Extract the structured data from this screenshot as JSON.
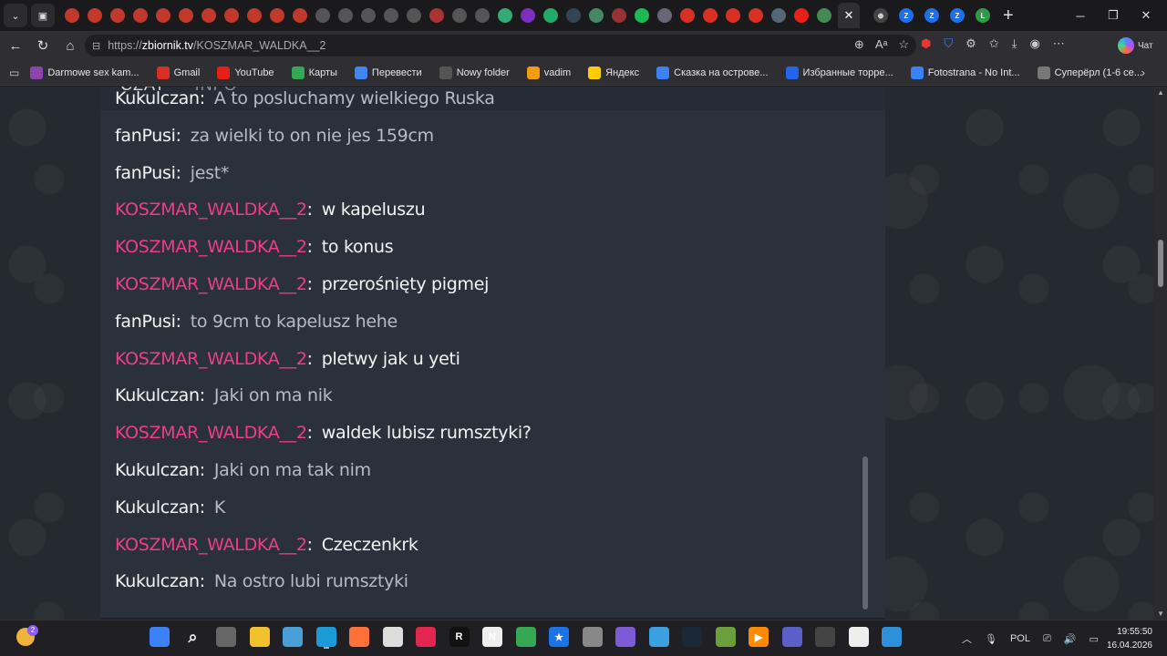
{
  "browser": {
    "url": {
      "protocol": "https://",
      "host": "zbiornik.tv",
      "path": "/KOSZMAR_WALDKA__2"
    },
    "copilot_label": "Чат",
    "tab_favicons": [
      {
        "icon": "red-circle-icon",
        "color": "#c0392b"
      },
      {
        "icon": "red-circle-icon",
        "color": "#c0392b"
      },
      {
        "icon": "red-circle-icon",
        "color": "#c0392b"
      },
      {
        "icon": "red-circle-icon",
        "color": "#c0392b"
      },
      {
        "icon": "red-circle-icon",
        "color": "#c0392b"
      },
      {
        "icon": "red-circle-icon",
        "color": "#c0392b"
      },
      {
        "icon": "red-circle-icon",
        "color": "#c0392b"
      },
      {
        "icon": "red-circle-icon",
        "color": "#c0392b"
      },
      {
        "icon": "red-circle-icon",
        "color": "#c0392b"
      },
      {
        "icon": "red-circle-icon",
        "color": "#c0392b"
      },
      {
        "icon": "red-circle-icon",
        "color": "#c0392b"
      },
      {
        "icon": "hd-icon",
        "color": "#555"
      },
      {
        "icon": "hd-icon",
        "color": "#555"
      },
      {
        "icon": "hd-icon",
        "color": "#555"
      },
      {
        "icon": "hd-icon",
        "color": "#555"
      },
      {
        "icon": "hd-icon",
        "color": "#555"
      },
      {
        "icon": "red-circle-icon",
        "color": "#a33"
      },
      {
        "icon": "hd-icon",
        "color": "#555"
      },
      {
        "icon": "hd-icon",
        "color": "#555"
      },
      {
        "icon": "chart-icon",
        "color": "#3a7"
      },
      {
        "icon": "purple-icon",
        "color": "#7b2fbf"
      },
      {
        "icon": "green-icon",
        "color": "#2a6"
      },
      {
        "icon": "steam-icon",
        "color": "#345"
      },
      {
        "icon": "image-icon",
        "color": "#486"
      },
      {
        "icon": "arrow-icon",
        "color": "#933"
      },
      {
        "icon": "spotify-icon",
        "color": "#1db954"
      },
      {
        "icon": "image-icon",
        "color": "#667"
      },
      {
        "icon": "gmail-icon",
        "color": "#d93025"
      },
      {
        "icon": "gmail-icon",
        "color": "#d93025"
      },
      {
        "icon": "gmail-icon",
        "color": "#d93025"
      },
      {
        "icon": "gmail-icon",
        "color": "#d93025"
      },
      {
        "icon": "image-icon",
        "color": "#567"
      },
      {
        "icon": "youtube-icon",
        "color": "#e62117"
      },
      {
        "icon": "image-icon",
        "color": "#485"
      }
    ],
    "active_tab_close": "✕",
    "right_tab_favicons": [
      {
        "icon": "globe-icon",
        "label": "⊕",
        "color": "#444"
      },
      {
        "icon": "z-icon",
        "label": "Z",
        "color": "#1f6feb"
      },
      {
        "icon": "z-icon",
        "label": "Z",
        "color": "#1f6feb"
      },
      {
        "icon": "z-icon",
        "label": "Z",
        "color": "#1f6feb"
      },
      {
        "icon": "l-icon",
        "label": "L",
        "color": "#2e9b4a"
      }
    ],
    "window_controls": [
      "─",
      "❐",
      "✕"
    ]
  },
  "bookmarks": [
    {
      "label": "Darmowe sex kam...",
      "icon": "camera-icon",
      "color": "#8e44ad"
    },
    {
      "label": "Gmail",
      "icon": "gmail-icon",
      "color": "#d93025"
    },
    {
      "label": "YouTube",
      "icon": "youtube-icon",
      "color": "#e62117"
    },
    {
      "label": "Карты",
      "icon": "maps-icon",
      "color": "#34a853"
    },
    {
      "label": "Перевести",
      "icon": "translate-icon",
      "color": "#4285f4"
    },
    {
      "label": "Nowy folder",
      "icon": "folder-icon",
      "color": "#555"
    },
    {
      "label": "vadim",
      "icon": "mail-icon",
      "color": "#f39c12"
    },
    {
      "label": "Яндекс",
      "icon": "yandex-icon",
      "color": "#ffcc00"
    },
    {
      "label": "Сказка на острове...",
      "icon": "star-icon",
      "color": "#3b82f6"
    },
    {
      "label": "Избранные торре...",
      "icon": "torrent-icon",
      "color": "#2563eb"
    },
    {
      "label": "Fotostrana - No Int...",
      "icon": "fotostrana-icon",
      "color": "#3b82f6"
    },
    {
      "label": "Суперёрл (1-6 се...",
      "icon": "hat-icon",
      "color": "#777"
    }
  ],
  "chat": {
    "tabs": [
      "CZAT",
      "INFO"
    ],
    "messages": [
      {
        "user": "Kukulczan",
        "text": "A to posluchamy wielkiego Ruska",
        "highlight": false
      },
      {
        "user": "fanPusi",
        "text": "za wielki to on nie jes 159cm",
        "highlight": false
      },
      {
        "user": "fanPusi",
        "text": "jest*",
        "highlight": false
      },
      {
        "user": "KOSZMAR_WALDKA__2",
        "text": "w kapeluszu",
        "highlight": true
      },
      {
        "user": "KOSZMAR_WALDKA__2",
        "text": "to konus",
        "highlight": true
      },
      {
        "user": "KOSZMAR_WALDKA__2",
        "text": "przerośnięty pigmej",
        "highlight": true
      },
      {
        "user": "fanPusi",
        "text": "to 9cm to kapelusz hehe",
        "highlight": false
      },
      {
        "user": "KOSZMAR_WALDKA__2",
        "text": "pletwy jak u yeti",
        "highlight": true
      },
      {
        "user": "Kukulczan",
        "text": "Jaki on ma nik",
        "highlight": false
      },
      {
        "user": "KOSZMAR_WALDKA__2",
        "text": "waldek lubisz rumsztyki?",
        "highlight": true
      },
      {
        "user": "Kukulczan",
        "text": "Jaki on ma tak nim",
        "highlight": false
      },
      {
        "user": "Kukulczan",
        "text": "K",
        "highlight": false
      },
      {
        "user": "KOSZMAR_WALDKA__2",
        "text": "Czeczenkrk",
        "highlight": true
      },
      {
        "user": "Kukulczan",
        "text": "Na ostro lubi rumsztyki",
        "highlight": false
      }
    ]
  },
  "taskbar": {
    "weather_badge": "2",
    "apps": [
      {
        "icon": "windows-start-icon",
        "label": "",
        "color": "#3b82f6"
      },
      {
        "icon": "search-icon",
        "label": "⌕",
        "color": "transparent"
      },
      {
        "icon": "task-view-icon",
        "label": "",
        "color": "#666"
      },
      {
        "icon": "file-explorer-icon",
        "label": "",
        "color": "#f2c12e"
      },
      {
        "icon": "photos-icon",
        "label": "",
        "color": "#4b9fd8"
      },
      {
        "icon": "edge-icon",
        "label": "",
        "color": "#1a9bd7"
      },
      {
        "icon": "firefox-icon",
        "label": "",
        "color": "#ff7139"
      },
      {
        "icon": "mpc-icon",
        "label": "",
        "color": "#ddd"
      },
      {
        "icon": "tiktok-icon",
        "label": "",
        "color": "#e3264f"
      },
      {
        "icon": "r-icon",
        "label": "R",
        "color": "#111"
      },
      {
        "icon": "n-icon",
        "label": "N",
        "color": "#eee"
      },
      {
        "icon": "chrome-icon",
        "label": "",
        "color": "#34a853"
      },
      {
        "icon": "star-app-icon",
        "label": "★",
        "color": "#1a73e8"
      },
      {
        "icon": "hat-app-icon",
        "label": "",
        "color": "#888"
      },
      {
        "icon": "game-icon",
        "label": "",
        "color": "#7b5cd6"
      },
      {
        "icon": "image-app-icon",
        "label": "",
        "color": "#3aa0e0"
      },
      {
        "icon": "steam-icon",
        "label": "",
        "color": "#1b2838"
      },
      {
        "icon": "minecraft-icon",
        "label": "",
        "color": "#6a9f3b"
      },
      {
        "icon": "media-player-icon",
        "label": "▶",
        "color": "#ff8a00"
      },
      {
        "icon": "teams-icon",
        "label": "",
        "color": "#5b5fc7"
      },
      {
        "icon": "obs-icon",
        "label": "",
        "color": "#444"
      },
      {
        "icon": "file-icon",
        "label": "",
        "color": "#eee"
      },
      {
        "icon": "browser-icon",
        "label": "",
        "color": "#2e90d8"
      }
    ],
    "language": "POL",
    "time": "19:55:50",
    "date": "16.04.2026"
  }
}
